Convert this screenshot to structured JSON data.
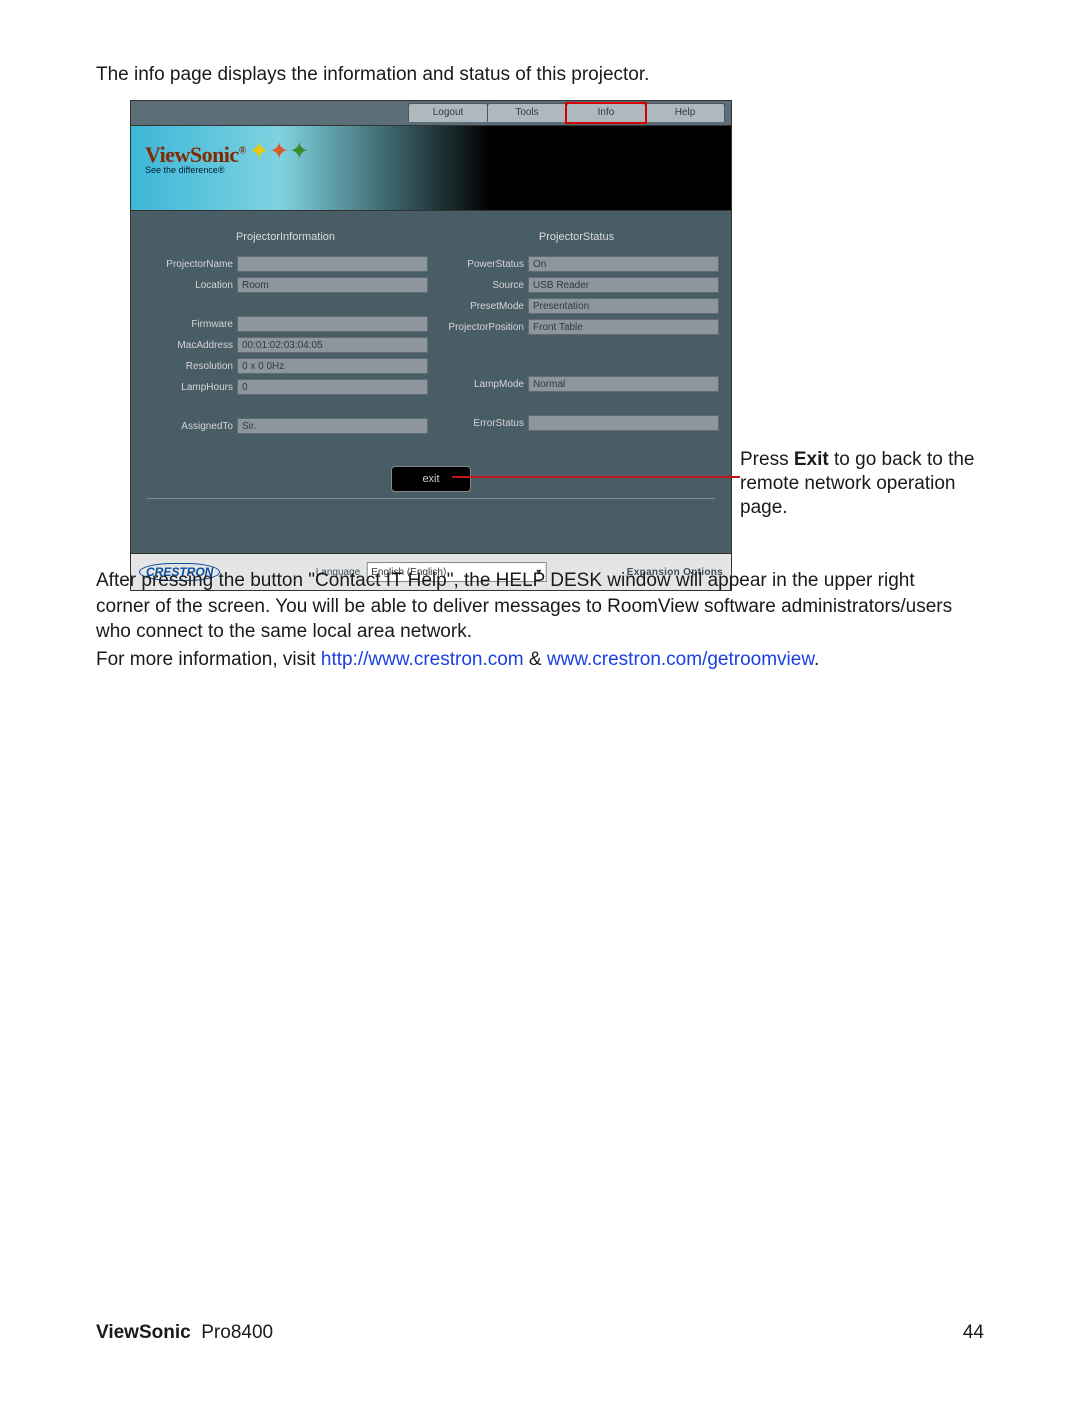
{
  "intro_text": "The info page displays the information and status of this projector.",
  "tabs": {
    "logout": "Logout",
    "tools": "Tools",
    "info": "Info",
    "help": "Help"
  },
  "brand": {
    "name": "ViewSonic",
    "reg": "®",
    "tag": "See the difference®"
  },
  "section_headers": {
    "left": "ProjectorInformation",
    "right": "ProjectorStatus"
  },
  "left_rows": {
    "projector_name": {
      "label": "ProjectorName",
      "value": ""
    },
    "location": {
      "label": "Location",
      "value": "Room"
    },
    "blank": {
      "label": "",
      "value": ""
    },
    "firmware": {
      "label": "Firmware",
      "value": ""
    },
    "mac_address": {
      "label": "MacAddress",
      "value": "00:01:02:03:04:05"
    },
    "resolution": {
      "label": "Resolution",
      "value": "0 x 0 0Hz"
    },
    "lamp_hours": {
      "label": "LampHours",
      "value": "0"
    },
    "assigned_to": {
      "label": "AssignedTo",
      "value": "Sir."
    }
  },
  "right_rows": {
    "power_status": {
      "label": "PowerStatus",
      "value": "On"
    },
    "source": {
      "label": "Source",
      "value": "USB Reader"
    },
    "preset_mode": {
      "label": "PresetMode",
      "value": "Presentation"
    },
    "projector_position": {
      "label": "ProjectorPosition",
      "value": "Front Table"
    },
    "lamp_mode": {
      "label": "LampMode",
      "value": "Normal"
    },
    "error_status": {
      "label": "ErrorStatus",
      "value": ""
    }
  },
  "exit_label": "exit",
  "footer": {
    "crestron": "CRESTRON",
    "language_label": "Language",
    "language_value": "English (English)",
    "expansion": "Expansion Options"
  },
  "callout": {
    "t1": "Press ",
    "bold": "Exit",
    "t2": " to go back to the remote network operation page."
  },
  "body": {
    "p1a": "After pressing the button \"Contact IT Help\", the HELP DESK window will appear in the upper right corner of the screen. You will be able to deliver messages to RoomView software administrators/users who connect to the same local area network.",
    "p2a": "For more information, visit ",
    "link1": "http://www.crestron.com",
    "amp": " & ",
    "link2": "www.crestron.com/getroomview",
    "p2b": "."
  },
  "page_footer": {
    "brand": "ViewSonic",
    "model": "Pro8400",
    "page_num": "44"
  }
}
